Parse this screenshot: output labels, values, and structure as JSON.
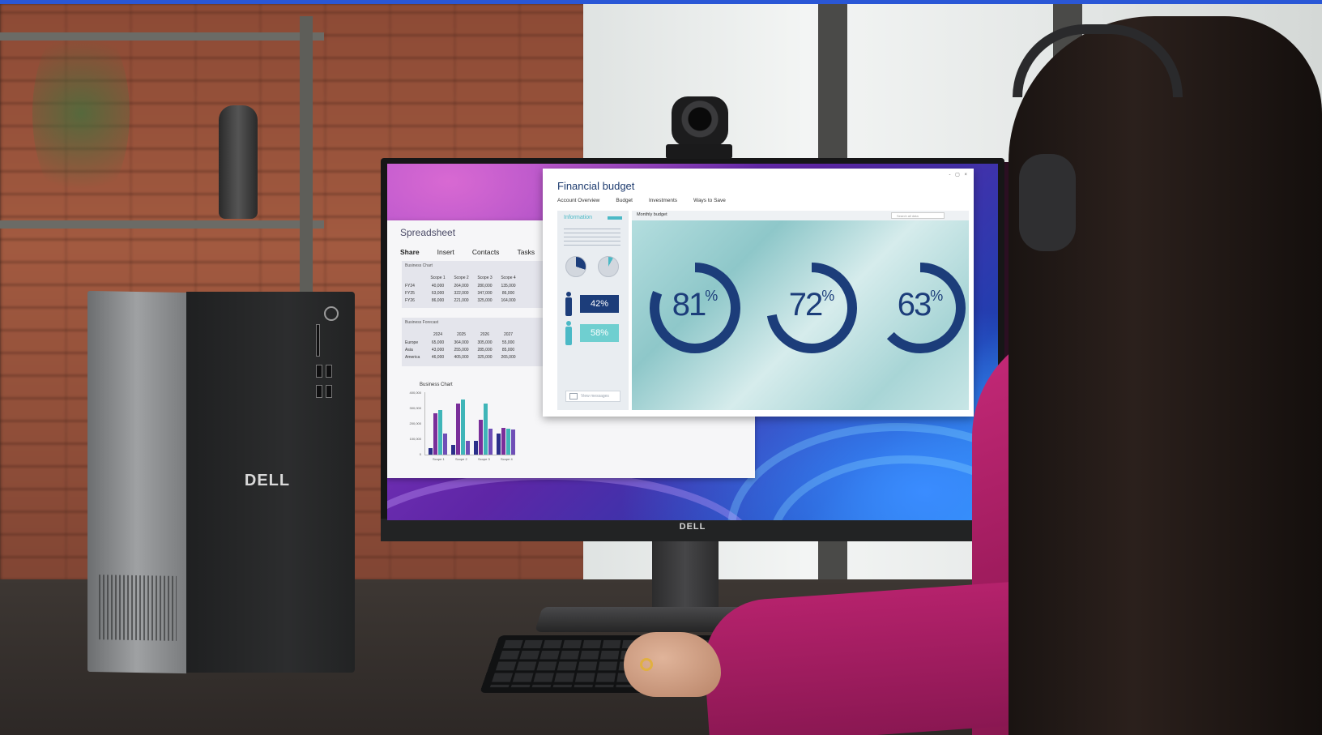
{
  "brand": {
    "tower_logo": "DELL",
    "monitor_logo": "DELL"
  },
  "spreadsheet": {
    "title": "Spreadsheet",
    "tabs": [
      "Share",
      "Insert",
      "Contacts",
      "Tasks"
    ],
    "table1": {
      "caption": "Business Chart",
      "headers": [
        "",
        "Scope 1",
        "Scope 2",
        "Scope 3",
        "Scope 4"
      ],
      "rows": [
        [
          "FY24",
          "40,000",
          "264,000",
          "280,000",
          "135,000"
        ],
        [
          "FY25",
          "63,000",
          "322,000",
          "347,000",
          "86,000"
        ],
        [
          "FY26",
          "86,000",
          "221,000",
          "325,000",
          "164,000"
        ]
      ]
    },
    "table2": {
      "caption": "Business Forecast",
      "headers": [
        "",
        "2024",
        "2025",
        "2026",
        "2027"
      ],
      "rows": [
        [
          "Europe",
          "65,000",
          "364,000",
          "305,000",
          "55,000"
        ],
        [
          "Asia",
          "43,000",
          "255,000",
          "285,000",
          "85,000"
        ],
        [
          "America",
          "46,000",
          "405,000",
          "325,000",
          "265,000"
        ]
      ]
    },
    "chart": {
      "caption": "Business Chart",
      "y_ticks": [
        "400,000",
        "300,000",
        "200,000",
        "100,000",
        "0"
      ],
      "x_ticks": [
        "Scope 1",
        "Scope 2",
        "Scope 3",
        "Scope 4"
      ],
      "colors": [
        "#2b2f8a",
        "#7a2f9a",
        "#3fb5b8",
        "#6f4fb7"
      ],
      "values": [
        [
          40000,
          63000,
          86000,
          135000
        ],
        [
          264000,
          322000,
          221000,
          170000
        ],
        [
          280000,
          347000,
          325000,
          164000
        ],
        [
          135000,
          86000,
          164000,
          160000
        ]
      ],
      "ymax": 400000
    }
  },
  "financial": {
    "title": "Financial budget",
    "tabs": [
      "Account Overview",
      "Budget",
      "Investments",
      "Ways to Save"
    ],
    "info": {
      "title": "Information",
      "male_pct": "42%",
      "female_pct": "58%",
      "button_label": "View messages"
    },
    "monthly": {
      "title": "Monthly budget",
      "search_placeholder": "Search all data",
      "rings": [
        {
          "value": 81,
          "label": "81"
        },
        {
          "value": 72,
          "label": "72"
        },
        {
          "value": 63,
          "label": "63"
        }
      ],
      "ring_color": "#1c3d7a",
      "pct_symbol": "%"
    },
    "window_controls": "- ▢ ×"
  },
  "colors": {
    "top_bar": "#2a57d6",
    "dark_blue": "#1c3d7a",
    "teal": "#4bb9c6"
  }
}
